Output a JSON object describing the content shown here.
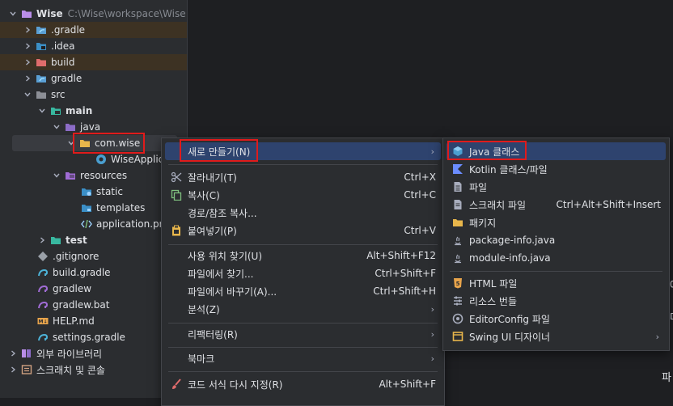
{
  "tree": {
    "project": {
      "name": "Wise",
      "path": "C:\\Wise\\workspace\\Wise"
    },
    "items": [
      {
        "label": ".gradle"
      },
      {
        "label": ".idea"
      },
      {
        "label": "build"
      },
      {
        "label": "gradle"
      },
      {
        "label": "src"
      },
      {
        "label": "main"
      },
      {
        "label": "java"
      },
      {
        "label": "com.wise"
      },
      {
        "label": "WiseApplic"
      },
      {
        "label": "resources"
      },
      {
        "label": "static"
      },
      {
        "label": "templates"
      },
      {
        "label": "application.pro"
      },
      {
        "label": "test"
      },
      {
        "label": ".gitignore"
      },
      {
        "label": "build.gradle"
      },
      {
        "label": "gradlew"
      },
      {
        "label": "gradlew.bat"
      },
      {
        "label": "HELP.md"
      },
      {
        "label": "settings.gradle"
      },
      {
        "label": "외부 라이브러리"
      },
      {
        "label": "스크래치 및 콘솔"
      }
    ]
  },
  "context_menu": {
    "items": [
      {
        "label": "새로 만들기(N)",
        "shortcut": ""
      },
      {
        "label": "잘라내기(T)",
        "shortcut": "Ctrl+X"
      },
      {
        "label": "복사(C)",
        "shortcut": "Ctrl+C"
      },
      {
        "label": "경로/참조 복사...",
        "shortcut": ""
      },
      {
        "label": "붙여넣기(P)",
        "shortcut": "Ctrl+V"
      },
      {
        "label": "사용 위치 찾기(U)",
        "shortcut": "Alt+Shift+F12"
      },
      {
        "label": "파일에서 찾기...",
        "shortcut": "Ctrl+Shift+F"
      },
      {
        "label": "파일에서 바꾸기(A)...",
        "shortcut": "Ctrl+Shift+H"
      },
      {
        "label": "분석(Z)",
        "shortcut": ""
      },
      {
        "label": "리팩터링(R)",
        "shortcut": ""
      },
      {
        "label": "북마크",
        "shortcut": ""
      },
      {
        "label": "코드 서식 다시 지정(R)",
        "shortcut": "Alt+Shift+F"
      }
    ]
  },
  "new_submenu": {
    "items": [
      {
        "label": "Java 클래스",
        "shortcut": ""
      },
      {
        "label": "Kotlin 클래스/파일",
        "shortcut": ""
      },
      {
        "label": "파일",
        "shortcut": ""
      },
      {
        "label": "스크래치 파일",
        "shortcut": "Ctrl+Alt+Shift+Insert"
      },
      {
        "label": "패키지",
        "shortcut": ""
      },
      {
        "label": "package-info.java",
        "shortcut": ""
      },
      {
        "label": "module-info.java",
        "shortcut": ""
      },
      {
        "label": "HTML 파일",
        "shortcut": ""
      },
      {
        "label": "리소스 번들",
        "shortcut": ""
      },
      {
        "label": "EditorConfig 파일",
        "shortcut": ""
      },
      {
        "label": "Swing UI 디자이너",
        "shortcut": ""
      }
    ]
  },
  "editor_fragments": [
    "에",
    "다",
    "파"
  ],
  "colors": {
    "folder_yellow": "#e8b64b",
    "highlight_blue": "#2e436e",
    "red_box": "#e01b1b",
    "excluded_bg": "#3d3223"
  }
}
